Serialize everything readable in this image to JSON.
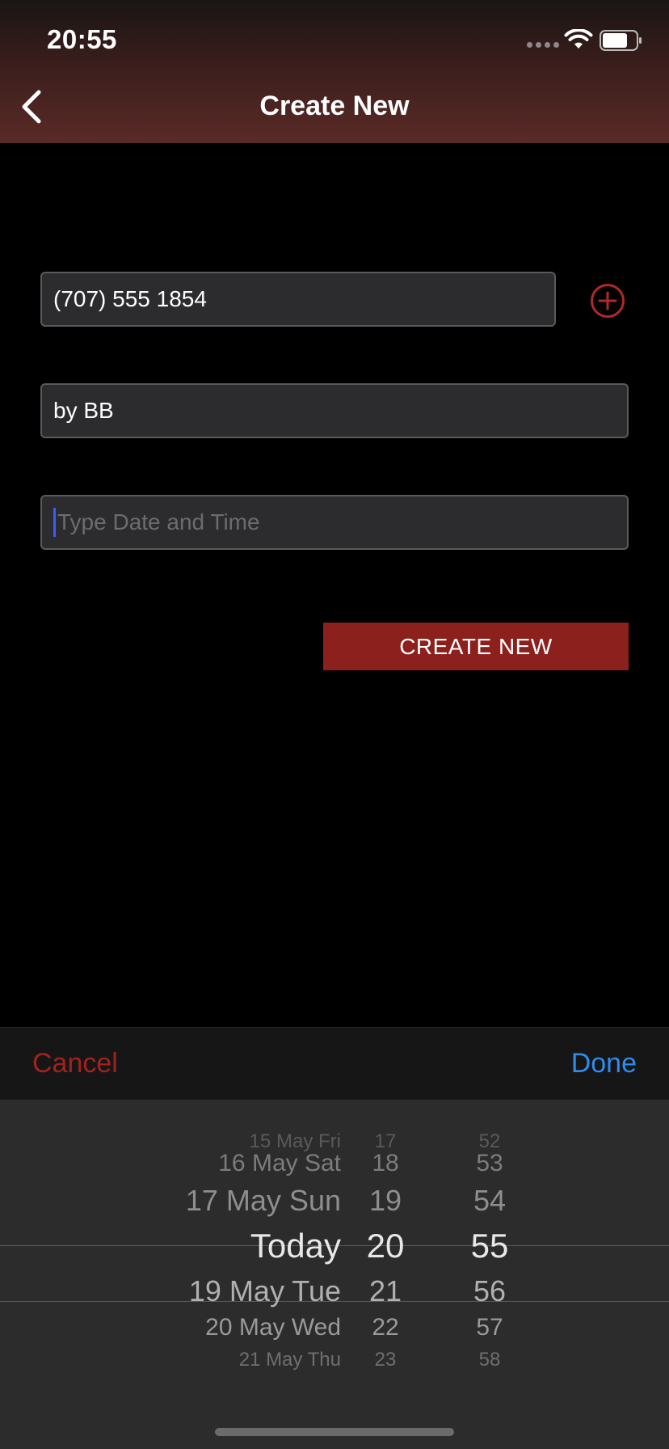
{
  "status_bar": {
    "time": "20:55"
  },
  "nav": {
    "title": "Create New"
  },
  "form": {
    "phone_value": "(707) 555 1854",
    "by_value": "by BB",
    "date_placeholder": "Type Date and Time",
    "submit_label": "CREATE NEW"
  },
  "picker_toolbar": {
    "cancel_label": "Cancel",
    "done_label": "Done"
  },
  "picker": {
    "days": [
      "15 May Fri",
      "16 May Sat",
      "17 May Sun",
      "Today",
      "19 May Tue",
      "20 May Wed",
      "21 May Thu"
    ],
    "hours": [
      "17",
      "18",
      "19",
      "20",
      "21",
      "22",
      "23"
    ],
    "minutes": [
      "52",
      "53",
      "54",
      "55",
      "56",
      "57",
      "58"
    ],
    "selected_day": "Today",
    "selected_hour": "20",
    "selected_minute": "55"
  },
  "colors": {
    "accent_red": "#8c201d",
    "link_blue": "#2d8cf0",
    "caret_blue": "#3b5cff"
  }
}
